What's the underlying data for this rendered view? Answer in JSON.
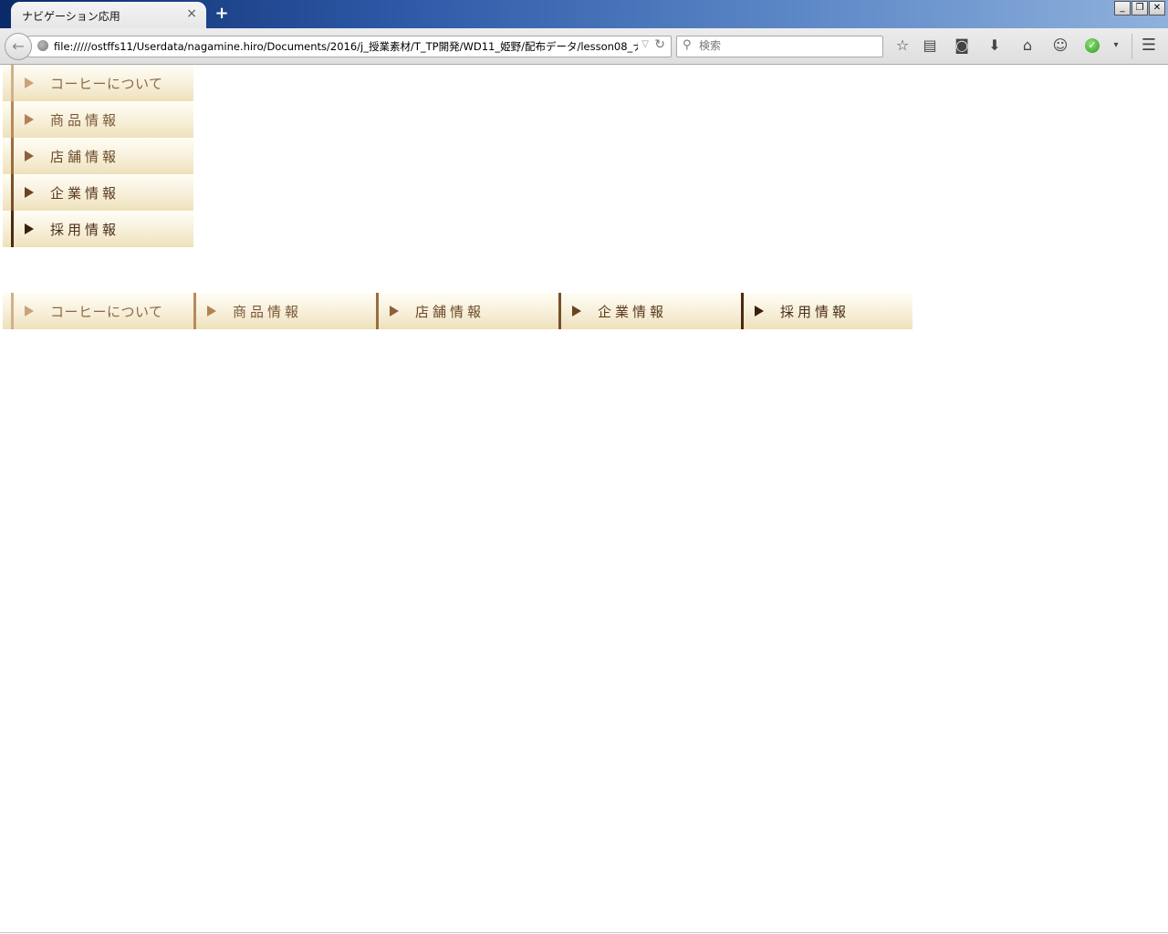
{
  "browser": {
    "tab_title": "ナビゲーション応用",
    "tab_close": "×",
    "new_tab": "+",
    "url": "file://///ostffs11/Userdata/nagamine.hiro/Documents/2016/j_授業素材/T_TP開発/WD11_姫野/配布データ/lesson08_ナビゲ-",
    "search_placeholder": "検索",
    "window_buttons": [
      "_",
      "❐",
      "✕"
    ]
  },
  "vertical_nav": {
    "items": [
      {
        "label": "コーヒーについて"
      },
      {
        "label": "商品情報"
      },
      {
        "label": "店舗情報"
      },
      {
        "label": "企業情報"
      },
      {
        "label": "採用情報"
      }
    ]
  },
  "horizontal_nav": {
    "items": [
      {
        "label": "コーヒーについて"
      },
      {
        "label": "商品情報"
      },
      {
        "label": "店舗情報"
      },
      {
        "label": "企業情報"
      },
      {
        "label": "採用情報"
      }
    ]
  },
  "colors": {
    "nav_gradient_top": "#fffdf6",
    "nav_gradient_bottom": "#eee1bb",
    "accent_light": "#d2b08a",
    "accent_dark": "#4a2a10"
  }
}
